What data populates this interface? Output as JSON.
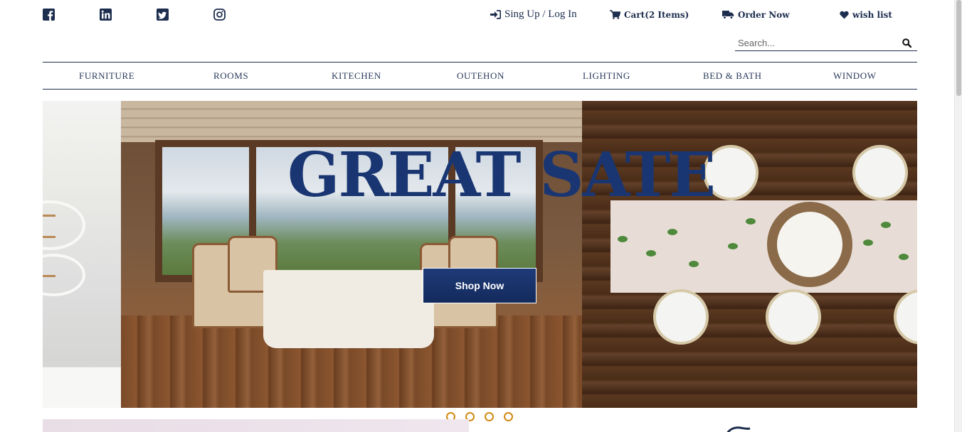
{
  "social": [
    "facebook-icon",
    "linkedin-icon",
    "twitter-icon",
    "instagram-icon"
  ],
  "top_links": {
    "signup": "Sing Up / Log In",
    "cart": "Cart(2 Items)",
    "order": "Order Now",
    "wishlist": "wish list"
  },
  "search": {
    "placeholder": "Search..."
  },
  "nav": [
    "FURNITURE",
    "ROOMS",
    "KITECHEN",
    "OUTEHON",
    "LIGHTING",
    "BED & BATH",
    "WINDOW"
  ],
  "hero": {
    "title": "GREAT SATE",
    "button": "Shop Now"
  },
  "carousel": {
    "slides": 4
  },
  "colors": {
    "brand": "#1d2d4e",
    "accent": "#d28a14",
    "button": "#1a3672"
  }
}
